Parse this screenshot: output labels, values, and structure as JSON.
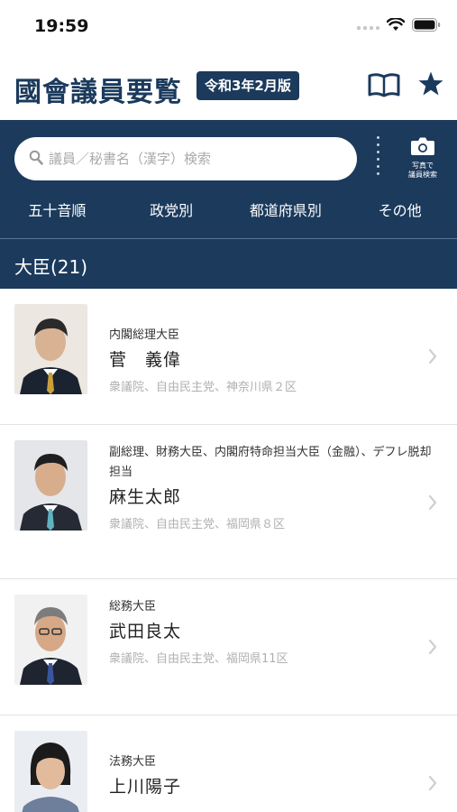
{
  "status_bar": {
    "time": "19:59"
  },
  "header": {
    "title": "國會議員要覧",
    "edition": "令和3年2月版",
    "book_icon": "book-icon",
    "favorite_icon": "star-icon"
  },
  "search": {
    "placeholder": "議員／秘書名（漢字）検索",
    "value": "",
    "camera_label_1": "写真で",
    "camera_label_2": "議員検索"
  },
  "filter_tabs": [
    "五十音順",
    "政党別",
    "都道府県別",
    "その他"
  ],
  "section": {
    "title": "大臣(21)"
  },
  "members": [
    {
      "position": "内閣総理大臣",
      "name": "菅　義偉",
      "affiliation": "衆議院、自由民主党、神奈川県２区"
    },
    {
      "position": "副総理、財務大臣、内閣府特命担当大臣（金融）、デフレ脱却担当",
      "name": "麻生太郎",
      "affiliation": "衆議院、自由民主党、福岡県８区"
    },
    {
      "position": "総務大臣",
      "name": "武田良太",
      "affiliation": "衆議院、自由民主党、福岡県11区"
    },
    {
      "position": "法務大臣",
      "name": "上川陽子",
      "affiliation": ""
    }
  ],
  "colors": {
    "navy": "#1b3a5c",
    "white": "#ffffff",
    "muted": "#b0b0b0"
  }
}
